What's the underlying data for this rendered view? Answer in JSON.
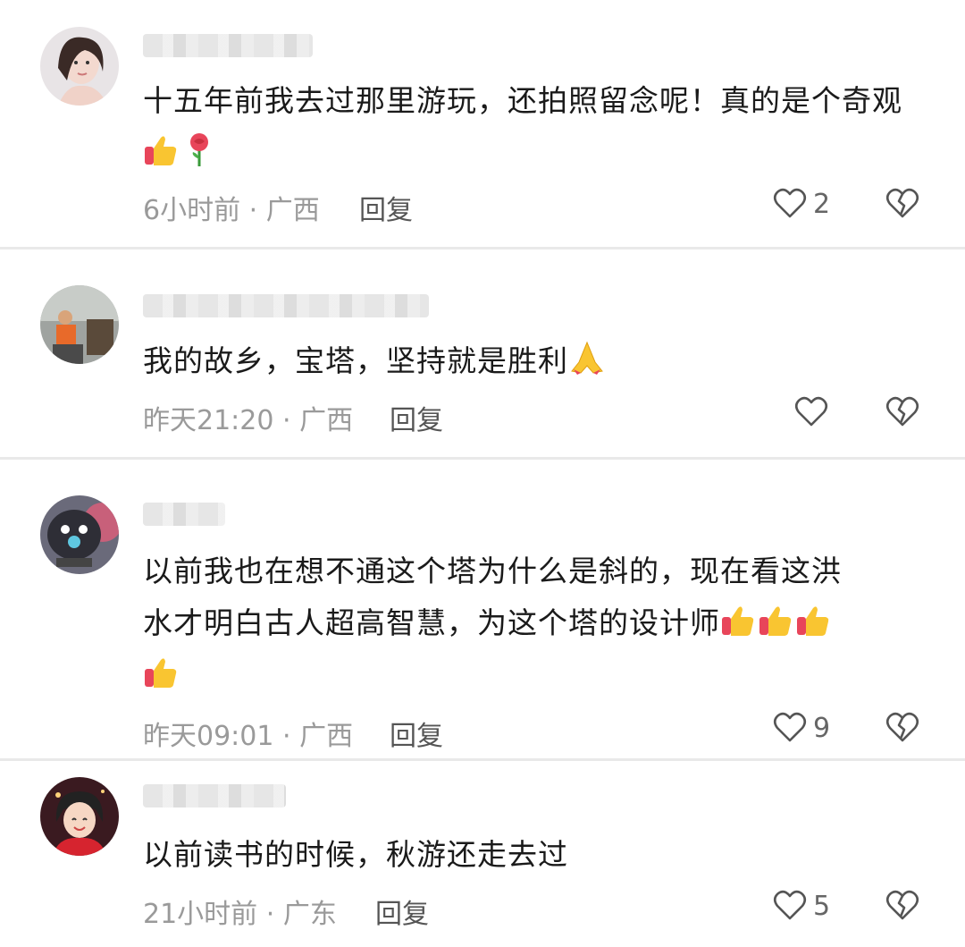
{
  "comments": [
    {
      "text_parts": [
        "十五年前我去过那里游玩，还拍照留念呢！真的是个奇观"
      ],
      "time": "6小时前",
      "region": "广西",
      "reply_label": "回复",
      "likes": "2"
    },
    {
      "text_parts": [
        "我的故乡，宝塔，坚持就是胜利"
      ],
      "time": "昨天21:20",
      "region": "广西",
      "reply_label": "回复",
      "likes": ""
    },
    {
      "text_parts": [
        "以前我也在想不通这个塔为什么是斜的，现在看这洪",
        "水才明白古人超高智慧，为这个塔的设计师"
      ],
      "time": "昨天09:01",
      "region": "广西",
      "reply_label": "回复",
      "likes": "9"
    },
    {
      "text_parts": [
        "以前读书的时候，秋游还走去过"
      ],
      "time": "21小时前",
      "region": "广东",
      "reply_label": "回复",
      "likes": "5"
    }
  ],
  "separator": "·",
  "icons": {
    "like": "heart-outline-icon",
    "dislike": "broken-heart-icon",
    "emoji_thumbs": "thumbs-up-emoji",
    "emoji_rose": "rose-emoji",
    "emoji_pray": "folded-hands-emoji"
  }
}
